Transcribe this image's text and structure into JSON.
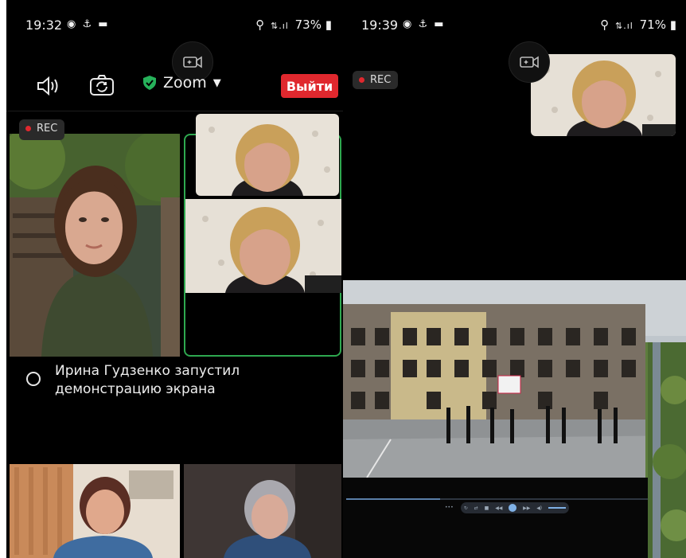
{
  "left_phone": {
    "status": {
      "time": "19:32",
      "battery": "73%"
    },
    "toolbar": {
      "meeting_title": "Zoom",
      "exit_label": "Выйти"
    },
    "rec_label": "REC",
    "notice_text": "Ирина Гудзенко запустил демонстрацию экрана"
  },
  "right_phone": {
    "status": {
      "time": "19:39",
      "battery": "71%"
    },
    "rec_label": "REC",
    "player": {
      "progress": 0.31
    }
  },
  "colors": {
    "background": "#000000",
    "exit_button": "#e0282e",
    "shield_green": "#26b15a",
    "active_speaker_border": "#2ea84f",
    "rec_dot": "#e0282e"
  },
  "icons": [
    "speaker-icon",
    "camera-switch-icon",
    "shield-check-icon",
    "chevron-down-icon",
    "camera-effects-icon",
    "location-icon",
    "signal-icon",
    "battery-icon",
    "play-pause-icon"
  ]
}
